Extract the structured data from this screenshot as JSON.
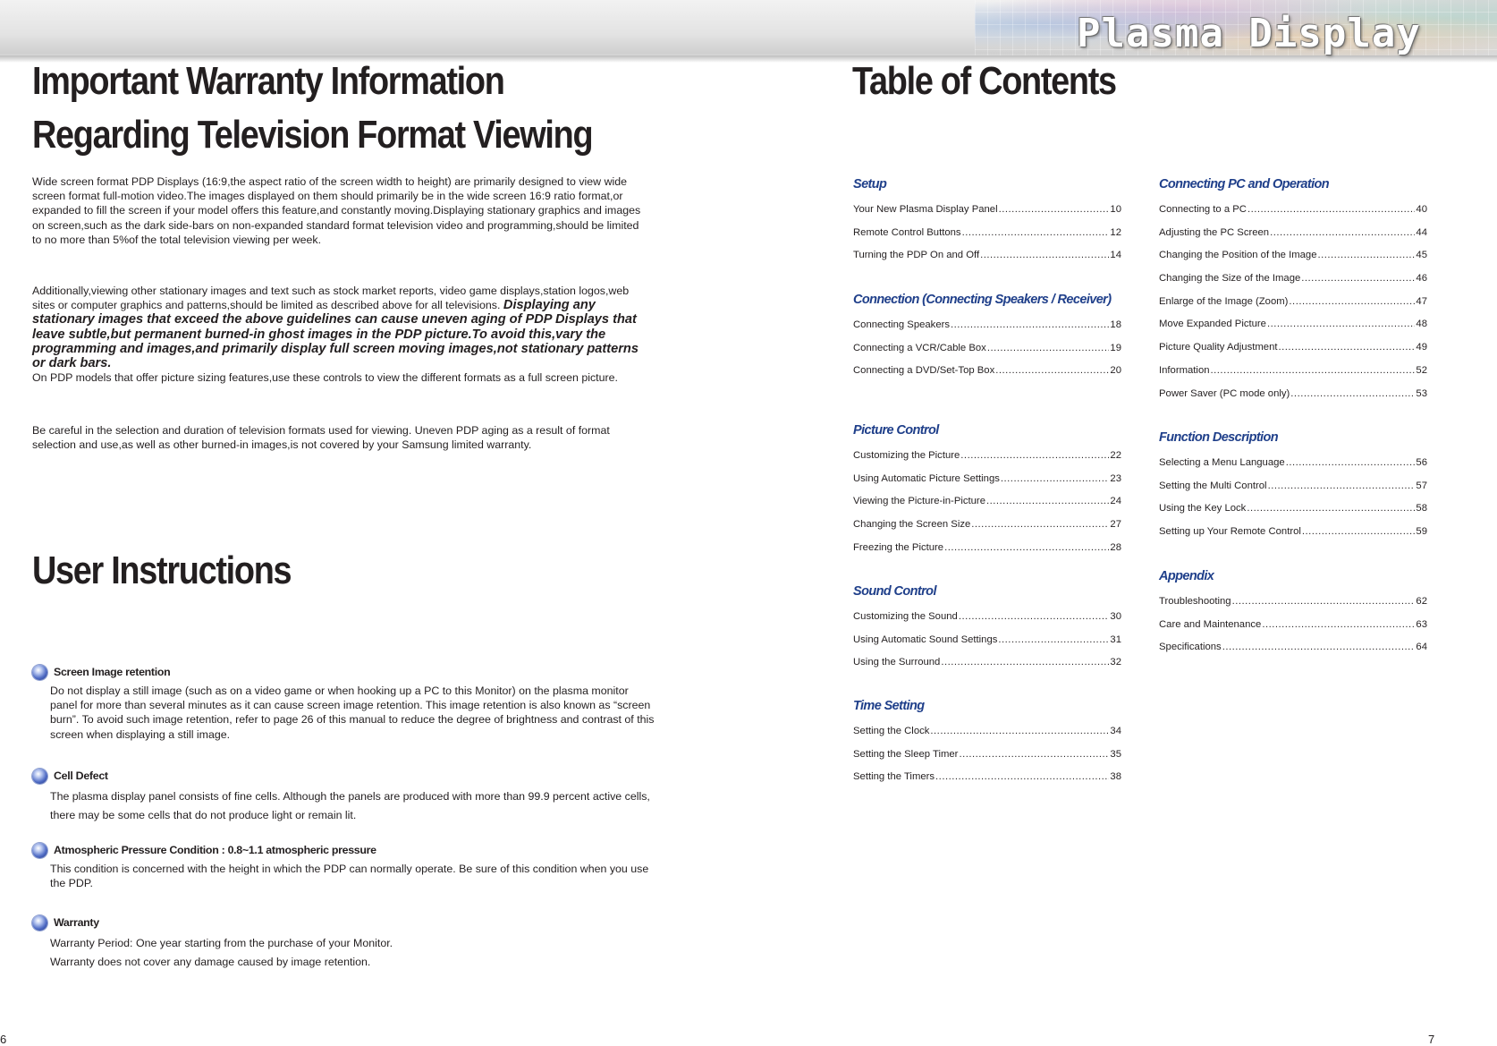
{
  "brand": "Plasma Display",
  "left": {
    "heading1_line1": "Important Warranty Information",
    "heading1_line2": "Regarding Television Format Viewing",
    "para1": "Wide screen format PDP Displays (16:9,the aspect ratio of the screen width to height) are primarily designed to view wide screen format full-motion video.The images displayed on them should primarily be in the wide screen 16:9 ratio format,or expanded to fill the screen if your model offers this feature,and constantly moving.Displaying stationary graphics and images on screen,such as the dark side-bars on non-expanded standard format television video and programming,should be limited to no more than 5%of the total television viewing per week.",
    "para2_lead": "Additionally,viewing other stationary images and text such as stock market reports, video game displays,station logos,web sites or computer graphics and patterns,should be limited as described above for all televisions.",
    "para2_emphasis": "Displaying any stationary images that exceed the above guidelines can cause uneven aging of PDP Displays that leave subtle,but permanent burned-in ghost images in the PDP picture.To avoid this,vary the programming and images,and primarily display full screen moving images,not stationary patterns or dark bars.",
    "para2_tail": "On PDP models that offer picture sizing features,use these controls to view the different formats as a full screen picture.",
    "para3": "Be careful in the selection and duration of television formats used for viewing. Uneven PDP aging as a result of format selection and use,as well as other burned-in images,is not covered by your Samsung limited warranty.",
    "heading2": "User Instructions",
    "instructions": [
      {
        "title": "Screen Image retention",
        "text": "Do not display a still image (such as on a video game or when hooking up a PC to this Monitor) on the plasma monitor panel for more than several minutes as it can cause screen image retention. This image retention is also known as “screen burn”. To avoid such image retention, refer to page 26 of this manual to reduce the degree of brightness and contrast of this screen when displaying a still image."
      },
      {
        "title": "Cell Defect",
        "text": "The plasma display panel consists of fine cells. Although the panels are produced with more than 99.9 percent active cells, there may be some cells that do not produce light or remain lit."
      },
      {
        "title": "Atmospheric Pressure Condition : 0.8~1.1 atmospheric pressure",
        "text": "This condition is concerned with the height in which the PDP can normally operate. Be sure of this condition when you use the PDP."
      },
      {
        "title": "Warranty",
        "text": "Warranty Period: One year starting from the purchase of your Monitor.",
        "text2": "Warranty does not cover any damage caused by image retention."
      }
    ],
    "page_number": "6"
  },
  "right": {
    "heading": "Table of Contents",
    "col1": [
      {
        "title": "Setup",
        "items": [
          {
            "label": "Your New Plasma Display Panel",
            "page": "10"
          },
          {
            "label": "Remote Control Buttons",
            "page": "12"
          },
          {
            "label": "Turning the PDP On and Off",
            "page": "14"
          }
        ]
      },
      {
        "title": "Connection (Connecting Speakers / Receiver)",
        "items": [
          {
            "label": "Connecting Speakers",
            "page": "18"
          },
          {
            "label": "Connecting a VCR/Cable Box",
            "page": "19"
          },
          {
            "label": "Connecting a DVD/Set-Top Box",
            "page": "20"
          }
        ]
      },
      {
        "title": "Picture Control",
        "items": [
          {
            "label": "Customizing the Picture",
            "page": "22"
          },
          {
            "label": "Using Automatic Picture Settings",
            "page": "23"
          },
          {
            "label": "Viewing the Picture-in-Picture",
            "page": "24"
          },
          {
            "label": "Changing the Screen Size",
            "page": "27"
          },
          {
            "label": "Freezing the Picture",
            "page": "28"
          }
        ]
      },
      {
        "title": "Sound Control",
        "items": [
          {
            "label": "Customizing the Sound",
            "page": "30"
          },
          {
            "label": "Using Automatic Sound Settings",
            "page": "31"
          },
          {
            "label": "Using the Surround",
            "page": "32"
          }
        ]
      },
      {
        "title": "Time Setting",
        "items": [
          {
            "label": "Setting the Clock",
            "page": "34"
          },
          {
            "label": "Setting the Sleep Timer",
            "page": "35"
          },
          {
            "label": "Setting the Timers",
            "page": "38"
          }
        ]
      }
    ],
    "col2": [
      {
        "title": "Connecting PC and Operation",
        "items": [
          {
            "label": "Connecting to a PC",
            "page": "40"
          },
          {
            "label": "Adjusting the PC Screen",
            "page": "44"
          },
          {
            "label": "Changing the Position of the Image",
            "page": "45"
          },
          {
            "label": "Changing the Size of the Image",
            "page": "46"
          },
          {
            "label": "Enlarge of the Image (Zoom)",
            "page": "47"
          },
          {
            "label": "Move Expanded Picture",
            "page": "48"
          },
          {
            "label": "Picture Quality Adjustment",
            "page": "49"
          },
          {
            "label": "Information",
            "page": "52"
          },
          {
            "label": "Power Saver (PC mode only)",
            "page": "53"
          }
        ]
      },
      {
        "title": "Function Description",
        "items": [
          {
            "label": "Selecting a Menu Language",
            "page": "56"
          },
          {
            "label": "Setting the Multi Control",
            "page": "57"
          },
          {
            "label": "Using the Key Lock",
            "page": "58"
          },
          {
            "label": "Setting up Your Remote Control",
            "page": "59"
          }
        ]
      },
      {
        "title": "Appendix",
        "items": [
          {
            "label": "Troubleshooting",
            "page": "62"
          },
          {
            "label": "Care and Maintenance",
            "page": "63"
          },
          {
            "label": "Specifications",
            "page": "64"
          }
        ]
      }
    ],
    "page_number": "7"
  }
}
